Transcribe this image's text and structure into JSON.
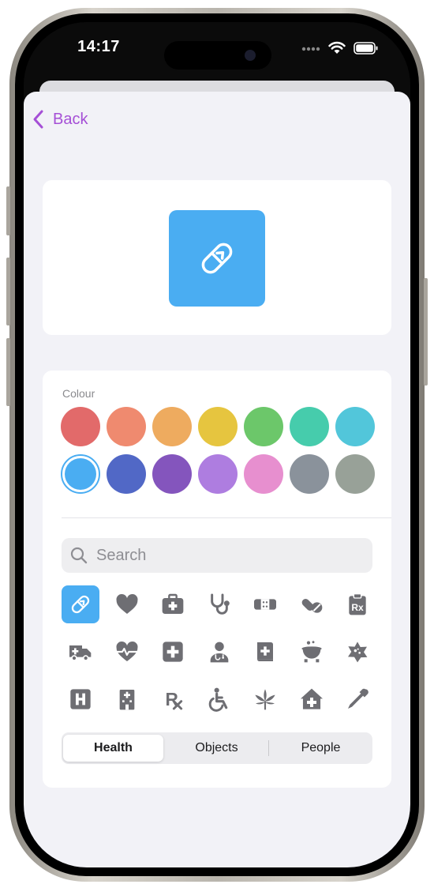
{
  "status_bar": {
    "time": "14:17"
  },
  "nav": {
    "back_label": "Back"
  },
  "preview": {
    "icon": "pill-icon",
    "color": "#4aadf2"
  },
  "colour_section": {
    "label": "Colour",
    "swatches": [
      "#e26a6a",
      "#ef8a6f",
      "#eeab5f",
      "#e6c53f",
      "#6cc76a",
      "#46ccac",
      "#52c6da",
      "#4aadf2",
      "#5168c6",
      "#8455bd",
      "#ae7de0",
      "#e78fcf",
      "#8a929b",
      "#98a198"
    ],
    "selected_index": 7
  },
  "search": {
    "placeholder": "Search",
    "value": ""
  },
  "icons": [
    "pill-icon",
    "heart-icon",
    "medical-bag-icon",
    "stethoscope-icon",
    "bandage-icon",
    "pills-icon",
    "prescription-clipboard-icon",
    "ambulance-icon",
    "heart-rate-icon",
    "medical-cross-icon",
    "doctor-icon",
    "medical-book-icon",
    "cauldron-icon",
    "virus-icon",
    "hospital-sign-icon",
    "hospital-building-icon",
    "rx-icon",
    "wheelchair-icon",
    "cannabis-leaf-icon",
    "clinic-house-icon",
    "dropper-icon"
  ],
  "selected_icon_index": 0,
  "categories": {
    "health": "Health",
    "objects": "Objects",
    "people": "People",
    "active": "Health"
  }
}
